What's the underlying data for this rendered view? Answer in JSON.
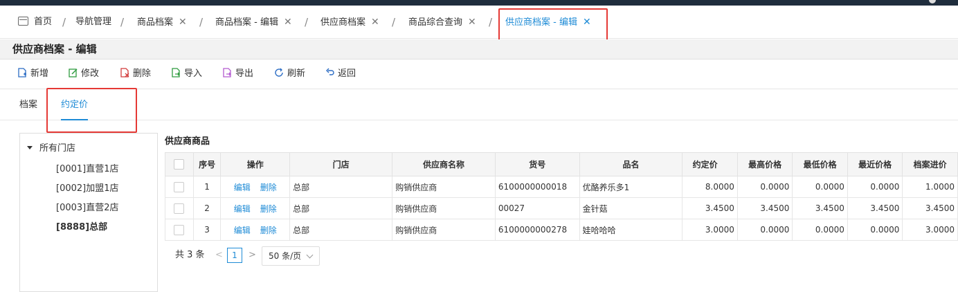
{
  "breadcrumb": [
    {
      "label": "首页",
      "closable": false
    },
    {
      "label": "导航管理",
      "closable": false
    },
    {
      "label": "商品档案",
      "closable": true
    },
    {
      "label": "商品档案 - 编辑",
      "closable": true
    },
    {
      "label": "供应商档案",
      "closable": true
    },
    {
      "label": "商品综合查询",
      "closable": true
    },
    {
      "label": "供应商档案 - 编辑",
      "closable": true,
      "active": true
    }
  ],
  "close_glyph": "✕",
  "page_title": "供应商档案 - 编辑",
  "toolbar": {
    "new": "新增",
    "edit": "修改",
    "delete": "删除",
    "import": "导入",
    "export": "导出",
    "refresh": "刷新",
    "back": "返回"
  },
  "tabs": [
    "档案",
    "约定价"
  ],
  "active_tab": "约定价",
  "tree": {
    "root": "所有门店",
    "items": [
      "[0001]直营1店",
      "[0002]加盟1店",
      "[0003]直营2店",
      "[8888]总部"
    ]
  },
  "grid": {
    "title": "供应商商品",
    "columns": [
      "序号",
      "操作",
      "门店",
      "供应商名称",
      "货号",
      "品名",
      "约定价",
      "最高价格",
      "最低价格",
      "最近价格",
      "档案进价"
    ],
    "action_edit": "编辑",
    "action_delete": "删除",
    "rows": [
      {
        "no": "1",
        "store": "总部",
        "supplier": "购销供应商",
        "code": "6100000000018",
        "name": "优酪养乐多1",
        "price": "8.0000",
        "max": "0.0000",
        "min": "0.0000",
        "last": "0.0000",
        "cost": "1.0000"
      },
      {
        "no": "2",
        "store": "总部",
        "supplier": "购销供应商",
        "code": "00027",
        "name": "金针菇",
        "price": "3.4500",
        "max": "3.4500",
        "min": "3.4500",
        "last": "3.4500",
        "cost": "3.4500"
      },
      {
        "no": "3",
        "store": "总部",
        "supplier": "购销供应商",
        "code": "6100000000278",
        "name": "娃哈哈哈",
        "price": "3.0000",
        "max": "0.0000",
        "min": "0.0000",
        "last": "0.0000",
        "cost": "3.0000"
      }
    ]
  },
  "pager": {
    "total": "共 3 条",
    "prev": "<",
    "page": "1",
    "next": ">",
    "page_size": "50 条/页"
  },
  "colors": {
    "accent": "#1e8bd6",
    "highlight_box": "#e53935",
    "negative_value": "#e02020"
  }
}
